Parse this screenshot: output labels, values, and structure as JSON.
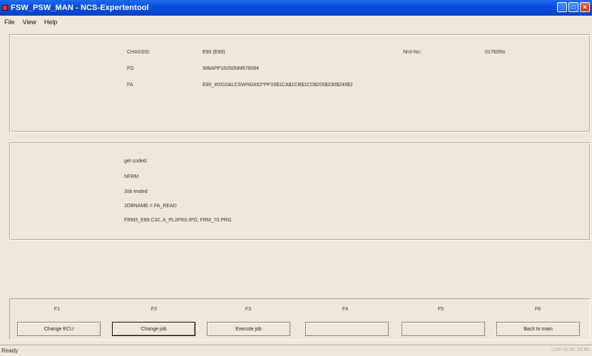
{
  "window": {
    "title": "FSW_PSW_MAN - NCS-Expertentool",
    "buttons": [
      "minimize-icon",
      "maximize-icon",
      "close-icon"
    ]
  },
  "menu": {
    "items": [
      "File",
      "View",
      "Help"
    ]
  },
  "vehicle": {
    "chassis_label": "CHASSIS:",
    "chassis_value": "E90 (E89)",
    "fg_label": "FG",
    "fg_value": "WBAPP16050NM678094",
    "fa_label": "FA",
    "fa_value": "E90_#0310&LCSW%0A52*PP16$1CA$1CB$1CD$205$230$249$2",
    "nrcl_label": "Nrcl-No.:",
    "nrcl_value": "017605is"
  },
  "log": {
    "lines": [
      "get coded:",
      "NFRM",
      "Job ended",
      "JOBNAME = FA_READ",
      "FRM3_E89.C32, A_PL2FRX.IPO, FRM_70.PRG"
    ]
  },
  "function_keys": [
    {
      "key": "F1",
      "label": "Change ECU"
    },
    {
      "key": "F2",
      "label": "Change job"
    },
    {
      "key": "F3",
      "label": "Execute job"
    },
    {
      "key": "F4",
      "label": ""
    },
    {
      "key": "F5",
      "label": ""
    },
    {
      "key": "F6",
      "label": "Back to main"
    }
  ],
  "status": {
    "left": "Ready",
    "right": "CAP NUM SCRL"
  }
}
